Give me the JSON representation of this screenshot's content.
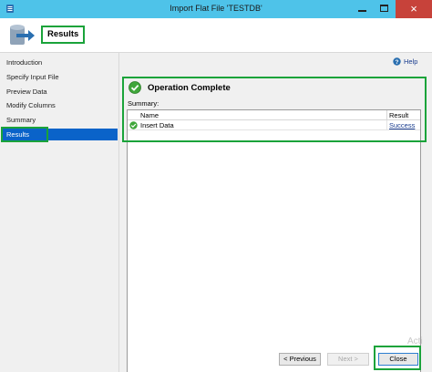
{
  "window": {
    "title": "Import Flat File 'TESTDB'",
    "close_glyph": "×",
    "icons": [
      "app-icon",
      "minimize-icon",
      "maximize-icon",
      "close-icon"
    ]
  },
  "header": {
    "title": "Results",
    "icon": "database-import-icon"
  },
  "sidebar": {
    "items": [
      {
        "label": "Introduction",
        "active": false
      },
      {
        "label": "Specify Input File",
        "active": false
      },
      {
        "label": "Preview Data",
        "active": false
      },
      {
        "label": "Modify Columns",
        "active": false
      },
      {
        "label": "Summary",
        "active": false
      },
      {
        "label": "Results",
        "active": true
      }
    ]
  },
  "main": {
    "help_label": "Help",
    "status_title": "Operation Complete",
    "status_icon": "success-check-icon",
    "summary_label": "Summary:",
    "table": {
      "columns": [
        "Name",
        "Result"
      ],
      "rows": [
        {
          "name": "Insert Data",
          "result": "Success",
          "icon": "success-check-icon"
        }
      ]
    }
  },
  "footer": {
    "previous_label": "< Previous",
    "next_label": "Next >",
    "close_label": "Close",
    "watermark": "Acti"
  },
  "colors": {
    "titlebar": "#4ec3e9",
    "highlight_outline": "#1aa33a",
    "selection": "#0a63c9",
    "close_button": "#c7423a"
  }
}
